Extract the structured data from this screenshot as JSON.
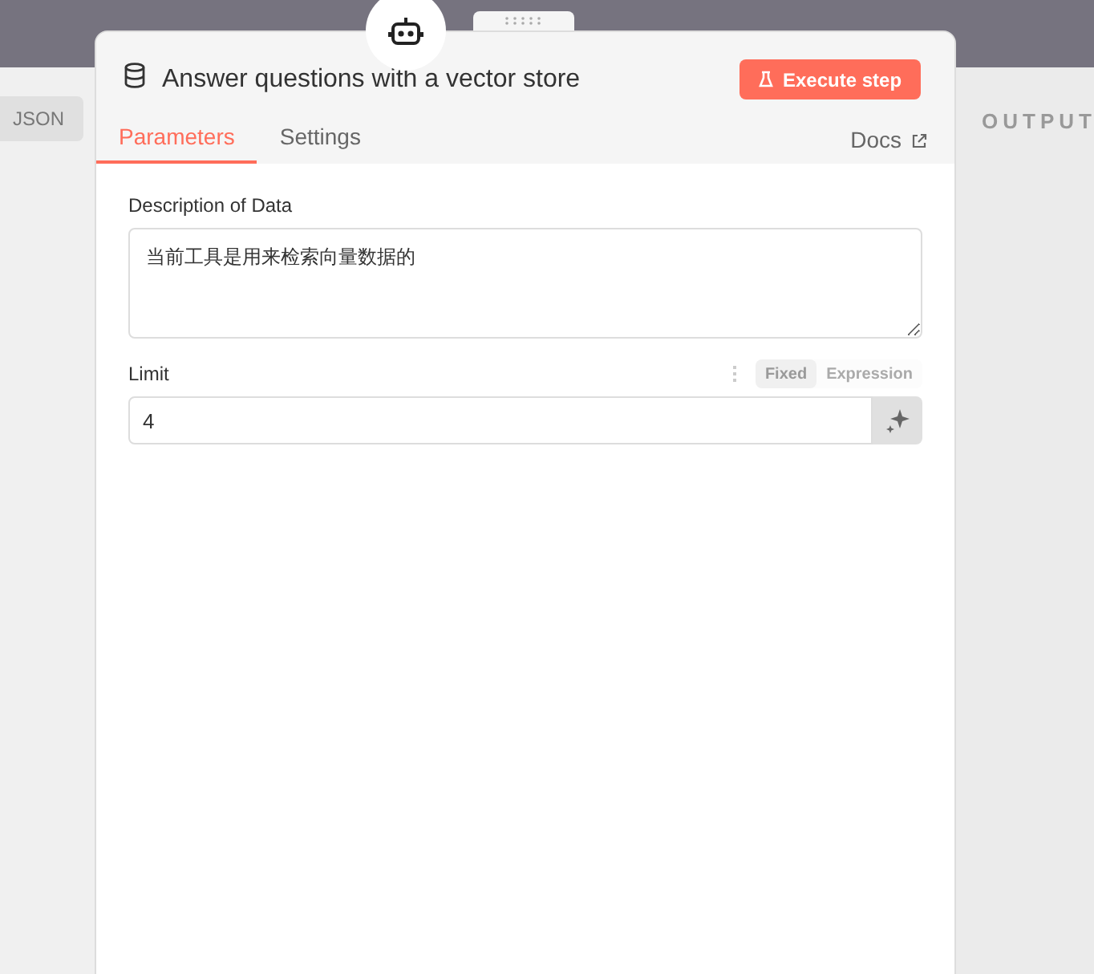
{
  "input_pane": {
    "json_tab": "JSON"
  },
  "output_pane": {
    "title": "OUTPUT"
  },
  "node_panel": {
    "title": "Answer questions with a vector store",
    "execute_button": "Execute step",
    "tabs": [
      {
        "label": "Parameters",
        "selected": true
      },
      {
        "label": "Settings",
        "selected": false
      }
    ],
    "docs_link": "Docs",
    "fields": [
      {
        "kind": "textarea",
        "label": "Description of Data",
        "value": "当前工具是用来检索向量数据的"
      },
      {
        "kind": "input",
        "label": "Limit",
        "value": "4",
        "mode_options": [
          {
            "label": "Fixed",
            "selected": true
          },
          {
            "label": "Expression",
            "selected": false
          }
        ]
      }
    ]
  }
}
